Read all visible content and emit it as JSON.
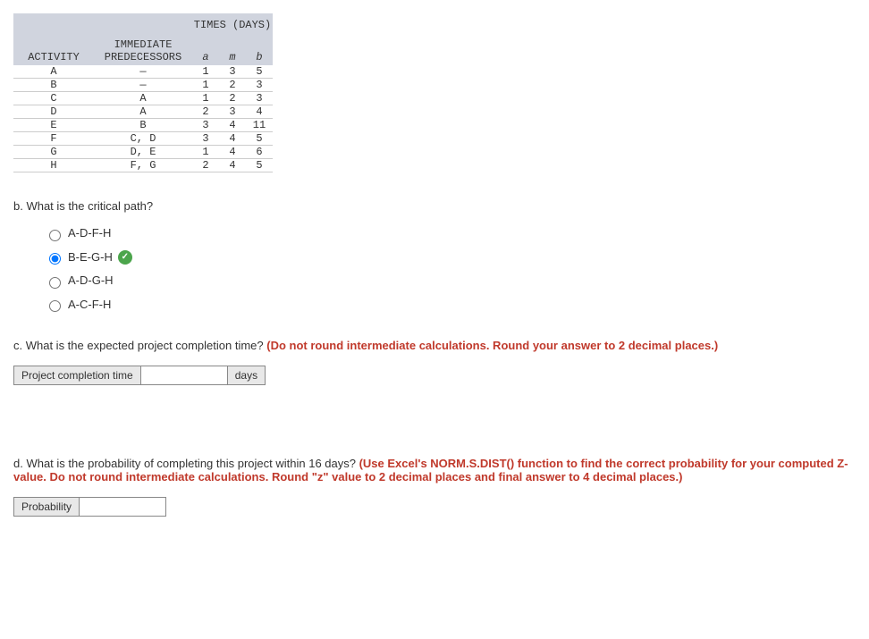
{
  "table": {
    "times_header": "TIMES (DAYS)",
    "col_activity": "ACTIVITY",
    "col_pred_line1": "IMMEDIATE",
    "col_pred_line2": "PREDECESSORS",
    "col_a": "a",
    "col_m": "m",
    "col_b": "b",
    "rows": [
      {
        "activity": "A",
        "pred": "—",
        "a": "1",
        "m": "3",
        "b": "5"
      },
      {
        "activity": "B",
        "pred": "—",
        "a": "1",
        "m": "2",
        "b": "3"
      },
      {
        "activity": "C",
        "pred": "A",
        "a": "1",
        "m": "2",
        "b": "3"
      },
      {
        "activity": "D",
        "pred": "A",
        "a": "2",
        "m": "3",
        "b": "4"
      },
      {
        "activity": "E",
        "pred": "B",
        "a": "3",
        "m": "4",
        "b": "11"
      },
      {
        "activity": "F",
        "pred": "C, D",
        "a": "3",
        "m": "4",
        "b": "5"
      },
      {
        "activity": "G",
        "pred": "D, E",
        "a": "1",
        "m": "4",
        "b": "6"
      },
      {
        "activity": "H",
        "pred": "F, G",
        "a": "2",
        "m": "4",
        "b": "5"
      }
    ]
  },
  "question_b": {
    "prompt": "b. What is the critical path?",
    "options": [
      {
        "label": "A-D-F-H",
        "selected": false,
        "correct": false
      },
      {
        "label": "B-E-G-H",
        "selected": true,
        "correct": true
      },
      {
        "label": "A-D-G-H",
        "selected": false,
        "correct": false
      },
      {
        "label": "A-C-F-H",
        "selected": false,
        "correct": false
      }
    ]
  },
  "question_c": {
    "prompt_black": "c. What is the expected project completion time? ",
    "prompt_red": "(Do not round intermediate calculations. Round your answer to 2 decimal places.)",
    "input_label": "Project completion time",
    "input_unit": "days",
    "input_value": ""
  },
  "question_d": {
    "prompt_black": "d. What is the probability of completing this project within 16 days? ",
    "prompt_red": "(Use Excel's NORM.S.DIST() function to find the correct probability for your computed Z-value. Do not round intermediate calculations. Round \"z\" value to 2 decimal places and final answer to 4 decimal places.)",
    "input_label": "Probability",
    "input_value": ""
  },
  "chart_data": {
    "type": "table",
    "title": "TIMES (DAYS)",
    "columns": [
      "ACTIVITY",
      "IMMEDIATE PREDECESSORS",
      "a",
      "m",
      "b"
    ],
    "rows": [
      [
        "A",
        "—",
        1,
        3,
        5
      ],
      [
        "B",
        "—",
        1,
        2,
        3
      ],
      [
        "C",
        "A",
        1,
        2,
        3
      ],
      [
        "D",
        "A",
        2,
        3,
        4
      ],
      [
        "E",
        "B",
        3,
        4,
        11
      ],
      [
        "F",
        "C, D",
        3,
        4,
        5
      ],
      [
        "G",
        "D, E",
        1,
        4,
        6
      ],
      [
        "H",
        "F, G",
        2,
        4,
        5
      ]
    ]
  }
}
